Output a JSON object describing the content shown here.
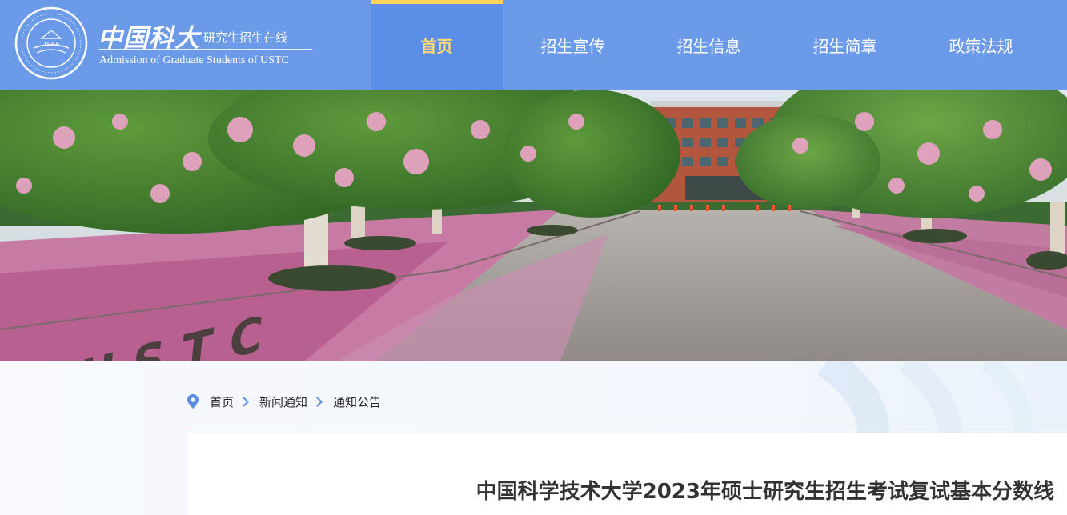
{
  "header": {
    "brand_cn": "中国科大",
    "brand_subtitle": "研究生招生在线",
    "brand_en": "Admission of Graduate Students of USTC",
    "seal_year": "1958",
    "seal_ring_text": "University of Science and Technology of China",
    "seal_top_text": "中国科学技术大学",
    "logo_icon": "ustc-seal-icon"
  },
  "nav": {
    "items": [
      {
        "label": "首页",
        "active": true
      },
      {
        "label": "招生宣传",
        "active": false
      },
      {
        "label": "招生信息",
        "active": false
      },
      {
        "label": "招生简章",
        "active": false
      },
      {
        "label": "政策法规",
        "active": false
      }
    ]
  },
  "banner": {
    "ground_text": "USTC"
  },
  "breadcrumb": {
    "icon": "location-pin-icon",
    "items": [
      "首页",
      "新闻通知",
      "通知公告"
    ]
  },
  "article": {
    "title": "中国科学技术大学2023年硕士研究生招生考试复试基本分数线"
  },
  "colors": {
    "header_bg": "#6a9ae8",
    "active_nav_bg": "#5b8ee6",
    "active_nav_text": "#ffd77a",
    "accent_bar": "#ffd35a",
    "breadcrumb_accent": "#5b8ee6"
  }
}
